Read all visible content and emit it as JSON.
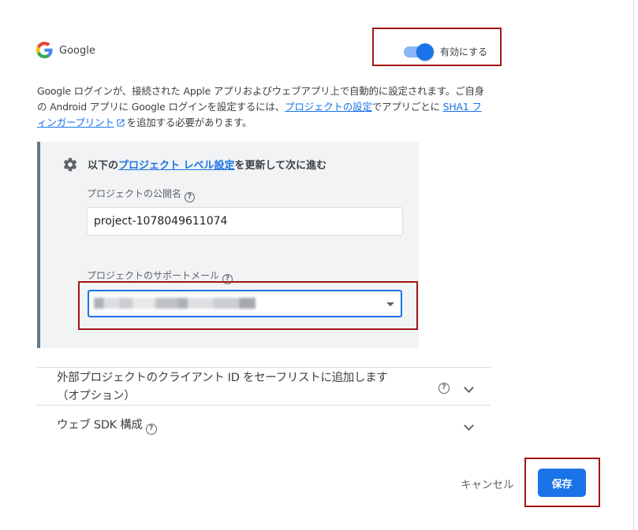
{
  "provider": {
    "name": "Google",
    "logo_icon": "google-g-icon"
  },
  "toggle": {
    "label": "有効にする",
    "enabled": true,
    "color": "#1a73e8"
  },
  "description": {
    "part1": "Google ログインが、接続された Apple アプリおよびウェブアプリ上で自動的に設定されます。ご自身の Android アプリに Google ログインを設定するには、",
    "link1": "プロジェクトの設定",
    "part2": "でアプリごとに ",
    "link2": "SHA1 フィンガープリント",
    "part3": "を追加する必要があります。"
  },
  "panel": {
    "icon": "gear-icon",
    "title_prefix": "以下の",
    "title_link": "プロジェクト レベル設定",
    "title_suffix": "を更新して次に進む",
    "public_name_label": "プロジェクトの公開名",
    "public_name_value": "project-1078049611074",
    "support_email_label": "プロジェクトのサポートメール",
    "support_email_value": ""
  },
  "accordions": [
    {
      "label_line1": "外部プロジェクトのクライアント ID をセーフリストに追加します",
      "label_line2": "（オプション）"
    },
    {
      "label_line1": "ウェブ SDK 構成"
    }
  ],
  "footer": {
    "cancel_label": "キャンセル",
    "save_label": "保存",
    "accent": "#1a73e8",
    "highlight_color": "#a31515"
  }
}
